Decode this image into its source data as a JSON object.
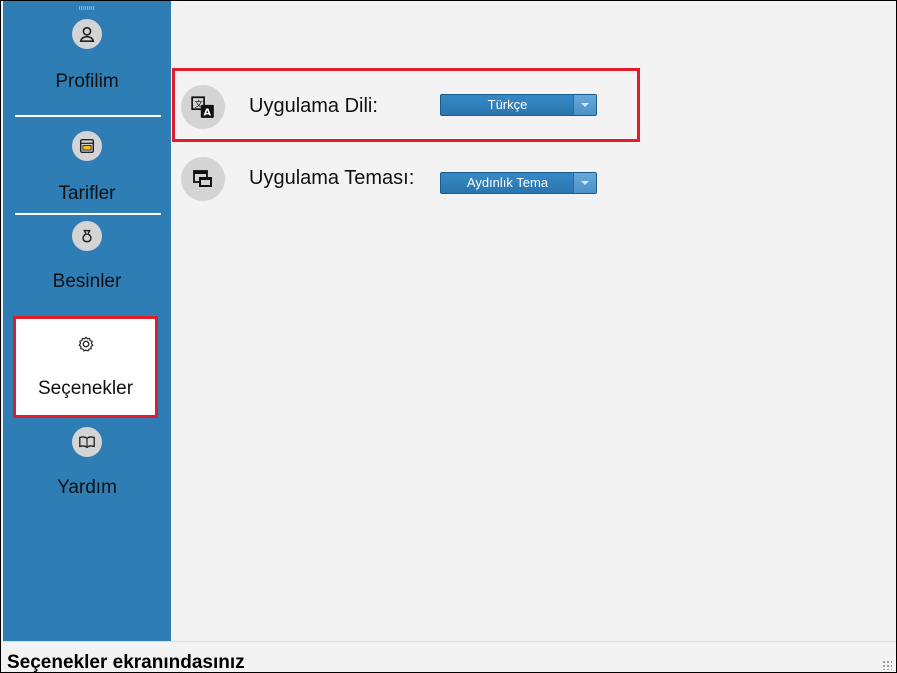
{
  "sidebar": {
    "items": [
      {
        "label": "Profilim",
        "icon": "profile-icon"
      },
      {
        "label": "Tarifler",
        "icon": "oven-icon"
      },
      {
        "label": "Besinler",
        "icon": "food-bag-icon"
      },
      {
        "label": "Seçenekler",
        "icon": "gear-icon",
        "selected": true
      },
      {
        "label": "Yardım",
        "icon": "book-icon"
      }
    ]
  },
  "settings": {
    "language": {
      "label": "Uygulama Dili:",
      "value": "Türkçe",
      "icon": "translate-icon"
    },
    "theme": {
      "label": "Uygulama Teması:",
      "value": "Aydınlık Tema",
      "icon": "theme-windows-icon"
    }
  },
  "status": {
    "text": "Seçenekler ekranındasınız"
  },
  "colors": {
    "sidebar": "#2e7db5",
    "highlight": "#e21d2b",
    "dropdown": "#2b76ad",
    "content_bg": "#f3f3f3"
  }
}
